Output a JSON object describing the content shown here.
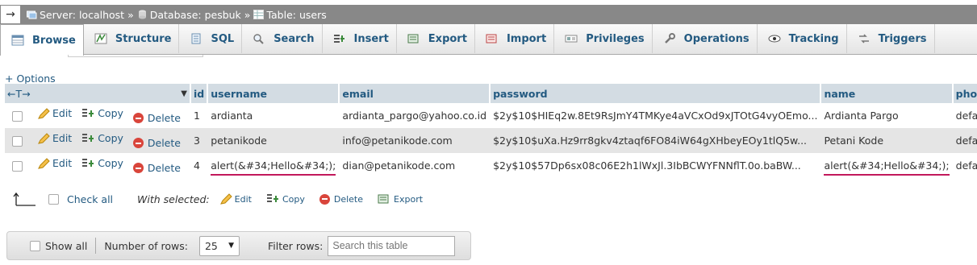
{
  "breadcrumb": {
    "back": "→",
    "server": "Server: localhost",
    "database": "Database: pesbuk",
    "table": "Table: users",
    "sep": "»"
  },
  "tabs": [
    "Browse",
    "Structure",
    "SQL",
    "Search",
    "Insert",
    "Export",
    "Import",
    "Privileges",
    "Operations",
    "Tracking",
    "Triggers"
  ],
  "options_label": "+ Options",
  "columns": [
    "id",
    "username",
    "email",
    "password",
    "name",
    "photo"
  ],
  "row_actions": {
    "edit": "Edit",
    "copy": "Copy",
    "delete": "Delete"
  },
  "rows": [
    {
      "id": "1",
      "username": "ardianta",
      "email": "ardianta_pargo@yahoo.co.id",
      "password": "$2y$10$HIEq2w.8Et9RsJmY4TMKye4aVCxOd9xJTOtG4vyOEmo...",
      "name": "Ardianta Pargo",
      "photo": "default.svg"
    },
    {
      "id": "3",
      "username": "petanikode",
      "email": "info@petanikode.com",
      "password": "$2y$10$uXa.Hz9rr8gkv4ztaqf6FO84iW64gXHbeyEOy1tlQ5w...",
      "name": "Petani Kode",
      "photo": "default.svg"
    },
    {
      "id": "4",
      "username": "alert(&#34;Hello&#34;);",
      "email": "dian@petanikode.com",
      "password": "$2y$10$57Dp6sx08c06E2h1lWxJl.3IbBCWYFNNflT.0o.baBW...",
      "name": "alert(&#34;Hello&#34;);",
      "photo": "default.svg"
    }
  ],
  "footer": {
    "check_all": "Check all",
    "with_selected": "With selected:",
    "edit": "Edit",
    "copy": "Copy",
    "delete": "Delete",
    "export": "Export"
  },
  "nav": {
    "show_all": "Show all",
    "rows_label": "Number of rows:",
    "rows_value": "25",
    "filter_label": "Filter rows:",
    "filter_placeholder": "Search this table"
  },
  "colors": {
    "link": "#235a81",
    "header_bg": "#d3dce3",
    "highlight": "#c2185b"
  }
}
